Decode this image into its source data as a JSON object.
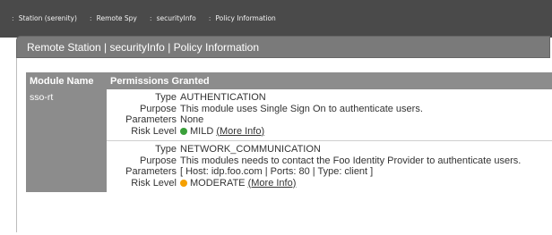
{
  "breadcrumbs": [
    {
      "label": "Station (serenity)"
    },
    {
      "label": "Remote Spy"
    },
    {
      "label": "securityInfo"
    },
    {
      "label": "Policy Information"
    }
  ],
  "panel": {
    "title": "Remote Station | securityInfo | Policy Information"
  },
  "table": {
    "headers": [
      "Module Name",
      "Permissions Granted"
    ],
    "module_name": "sso-rt",
    "field_labels": {
      "type": "Type",
      "purpose": "Purpose",
      "parameters": "Parameters",
      "risk_level": "Risk Level"
    },
    "permissions": [
      {
        "type": "AUTHENTICATION",
        "purpose": "This module uses Single Sign On to authenticate users.",
        "parameters": "None",
        "risk": "MILD",
        "risk_color": "#3aa03a",
        "more_info": "(More Info)"
      },
      {
        "type": "NETWORK_COMMUNICATION",
        "purpose": "This modules needs to contact the Foo Identity Provider to authenticate users.",
        "parameters": "[ Host: idp.foo.com | Ports: 80 | Type: client ]",
        "risk": "MODERATE",
        "risk_color": "#f5a000",
        "more_info": "(More Info)"
      }
    ]
  }
}
